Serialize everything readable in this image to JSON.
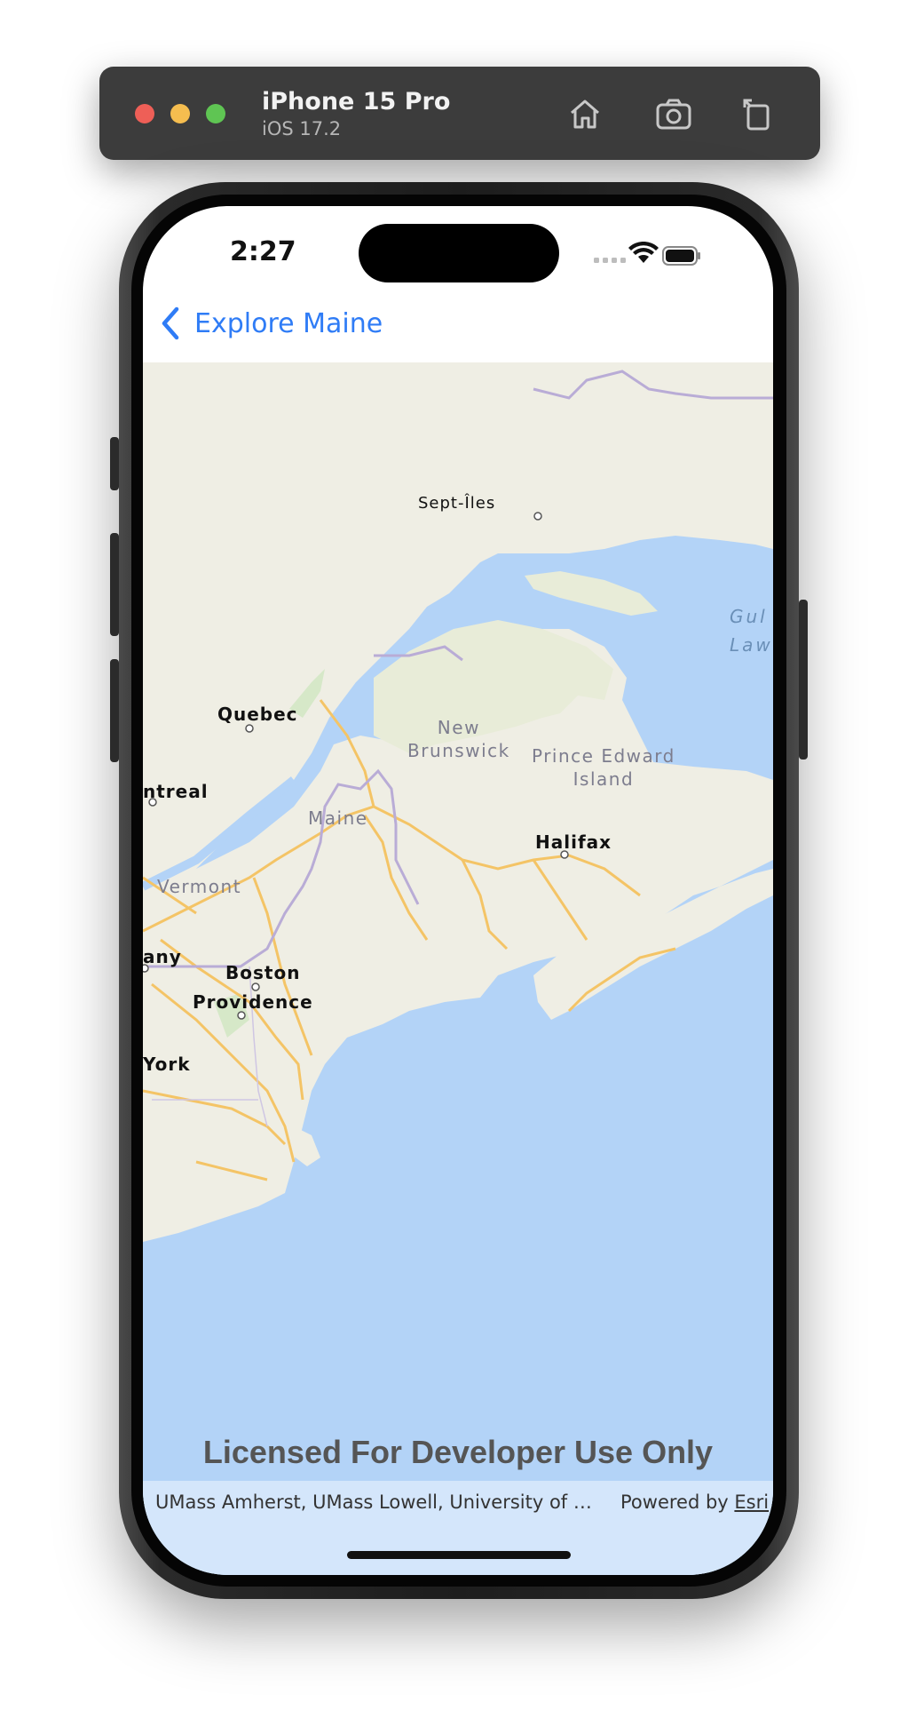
{
  "simulator": {
    "device_name": "iPhone 15 Pro",
    "os_version": "iOS 17.2",
    "toolbar_icons": [
      "home-icon",
      "screenshot-icon",
      "rotate-icon"
    ]
  },
  "status_bar": {
    "time": "2:27"
  },
  "nav": {
    "back_label": "Explore Maine"
  },
  "map": {
    "cities": [
      {
        "label": "Sept-Îles"
      },
      {
        "label": "Quebec"
      },
      {
        "label": "ntreal"
      },
      {
        "label": "Halifax"
      },
      {
        "label": "any"
      },
      {
        "label": "Boston"
      },
      {
        "label": "Providence"
      },
      {
        "label": "York"
      }
    ],
    "regions": {
      "new_brunswick": "New\nBrunswick",
      "prince_edward_island": "Prince Edward\nIsland",
      "maine": "Maine",
      "vermont": "Vermont"
    },
    "water": {
      "gulf": "Gul\nLaw"
    },
    "colors": {
      "water": "#b3d3f7",
      "land": "#efeee4",
      "roads": "#f4c466",
      "border": "#b9acd6"
    }
  },
  "overlay": {
    "license_text": "Licensed For Developer Use Only"
  },
  "attribution": {
    "sources": "UMass Amherst, UMass Lowell, University of New…",
    "powered_by": "Powered by",
    "esri": "Esri"
  }
}
